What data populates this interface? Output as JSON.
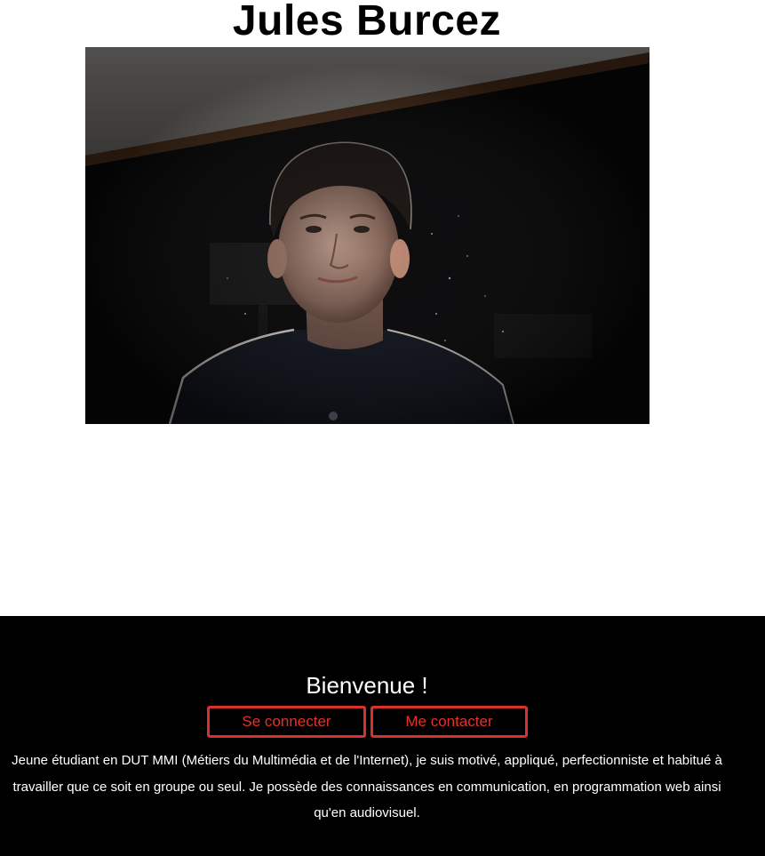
{
  "header": {
    "name": "Jules Burcez"
  },
  "photo": {
    "subject": "portrait-photo",
    "background_color": "#0b0b0c",
    "hoodie_color": "#151924"
  },
  "footer": {
    "welcome": "Bienvenue !",
    "buttons": {
      "login_label": "Se connecter",
      "contact_label": "Me contacter"
    },
    "bio": "Jeune étudiant en DUT MMI (Métiers du Multimédia et de l'Internet), je suis motivé, appliqué, perfectionniste et habitué à travailler que ce soit en groupe ou seul. Je possède des connaissances en communication, en programmation web ainsi qu'en audiovisuel.",
    "background_color": "#000000",
    "accent_color": "#e4312a"
  }
}
